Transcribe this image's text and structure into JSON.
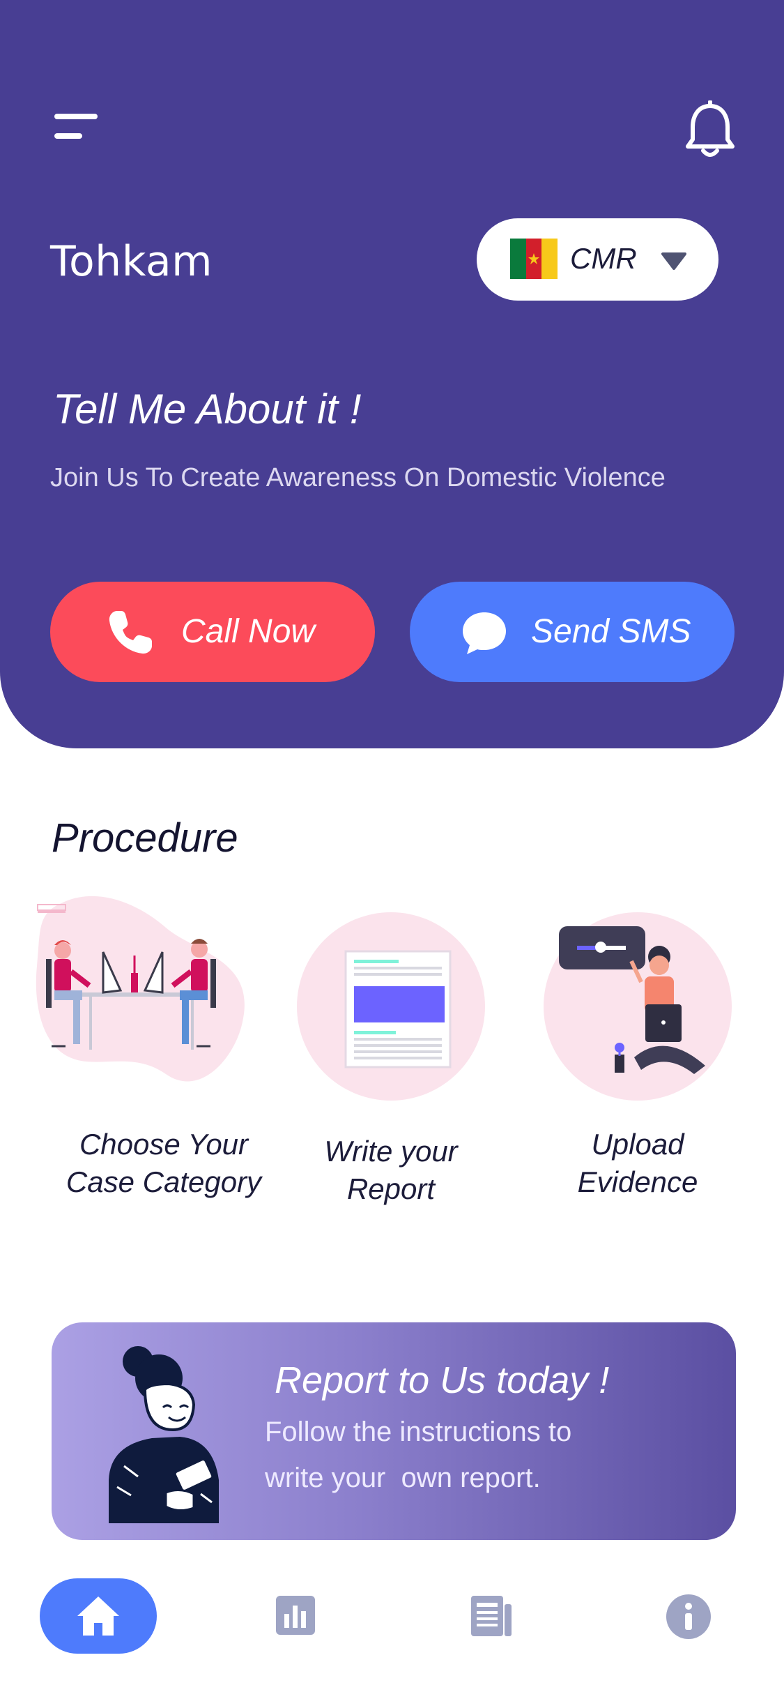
{
  "app": {
    "title": "Tohkam"
  },
  "header": {
    "menu_icon": "menu-icon",
    "notification_icon": "bell-icon",
    "country": {
      "code": "CMR",
      "flag_icon": "cameroon-flag-icon"
    },
    "tagline": "Tell Me About it !",
    "subtitle": "Join Us To Create Awareness On Domestic Violence"
  },
  "actions": {
    "call": {
      "label": "Call Now",
      "icon": "phone-icon",
      "color": "#fc4b5a"
    },
    "sms": {
      "label": "Send SMS",
      "icon": "chat-bubble-icon",
      "color": "#4e7bfc"
    }
  },
  "procedure": {
    "title": "Procedure",
    "steps": [
      {
        "line1": "Choose Your",
        "line2": "Case Category"
      },
      {
        "line1": "Write your",
        "line2": "Report"
      },
      {
        "line1": "Upload",
        "line2": "Evidence"
      }
    ]
  },
  "banner": {
    "title": "Report to Us today !",
    "line1": "Follow the instructions to",
    "line2": "write your  own report."
  },
  "nav": {
    "items": [
      {
        "icon": "home-icon",
        "active": true
      },
      {
        "icon": "stats-icon",
        "active": false
      },
      {
        "icon": "news-icon",
        "active": false
      },
      {
        "icon": "info-icon",
        "active": false
      }
    ]
  },
  "colors": {
    "primary": "#483e93",
    "accent_red": "#fc4b5a",
    "accent_blue": "#4e7bfc",
    "nav_icon": "#9ea4c4"
  }
}
